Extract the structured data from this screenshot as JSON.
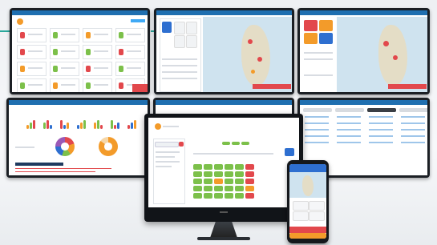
{
  "scene": {
    "description_labels": [],
    "accent_colors": {
      "header_blue": "#1f6fb0",
      "brand_orange": "#f39b2a",
      "alert_red": "#e2484c",
      "ok_green": "#7cc04a",
      "connector_teal": "#2aa89c"
    },
    "icons": [
      "monitor-icon",
      "smartphone-icon",
      "map-icon",
      "donut-chart-icon"
    ]
  }
}
